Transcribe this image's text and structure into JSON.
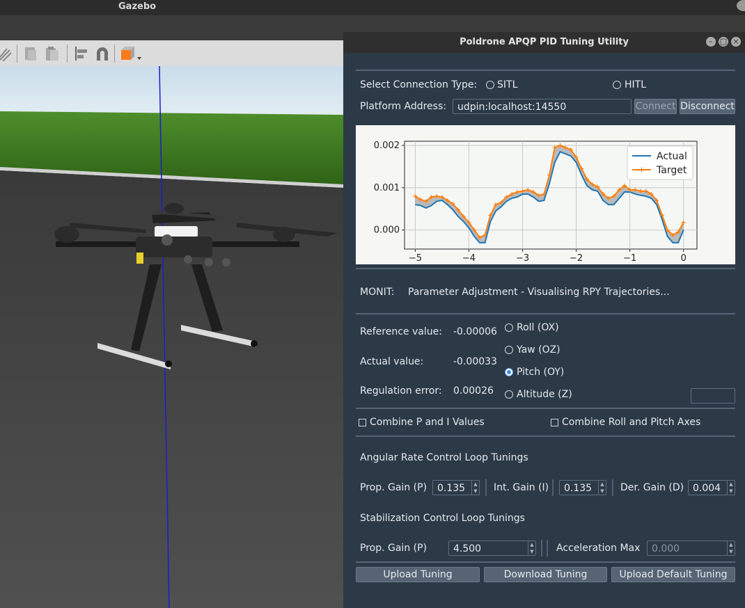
{
  "gazebo": {
    "title": "Gazebo"
  },
  "dialog": {
    "title": "Poldrone APQP PID Tuning Utility",
    "connection": {
      "label": "Select Connection Type:",
      "options": [
        "SITL",
        "HITL"
      ]
    },
    "address": {
      "label": "Platform Address:",
      "value": "udpin:localhost:14550",
      "connect_label": "Connect",
      "disconnect_label": "Disconnect"
    },
    "monit": {
      "label": "MONIT:",
      "status": "Parameter Adjustment - Visualising RPY Trajectories..."
    },
    "readouts": {
      "reference_label": "Reference value:",
      "reference_value": "-0.00006",
      "actual_label": "Actual value:",
      "actual_value": "-0.00033",
      "error_label": "Regulation error:",
      "error_value": "0.00026"
    },
    "axes": {
      "options": [
        "Roll (OX)",
        "Yaw (OZ)",
        "Pitch (OY)",
        "Altitude (Z)"
      ],
      "selected": "Pitch (OY)"
    },
    "checks": {
      "combine_pi": "Combine P and I Values",
      "combine_axes": "Combine Roll and Pitch Axes"
    },
    "angular": {
      "title": "Angular Rate Control Loop Tunings",
      "p_label": "Prop. Gain (P)",
      "p_value": "0.135",
      "i_label": "Int. Gain (I)",
      "i_value": "0.135",
      "d_label": "Der. Gain (D)",
      "d_value": "0.004"
    },
    "stabilization": {
      "title": "Stabilization Control Loop Tunings",
      "p_label": "Prop. Gain (P)",
      "p_value": "4.500",
      "acc_label": "Acceleration Max",
      "acc_value": "0.000"
    },
    "buttons": {
      "upload": "Upload Tuning",
      "download": "Download Tuning",
      "upload_default": "Upload Default Tuning"
    }
  },
  "chart_data": {
    "type": "line",
    "xlim": [
      -5.2,
      0.25
    ],
    "ylim": [
      -0.00045,
      0.0021
    ],
    "xticks": [
      -5,
      -4,
      -3,
      -2,
      -1,
      0
    ],
    "xtick_labels": [
      "−5",
      "−4",
      "−3",
      "−2",
      "−1",
      "0"
    ],
    "yticks": [
      0.0,
      0.001,
      0.002
    ],
    "ytick_labels": [
      "0.000",
      "0.001",
      "0.002"
    ],
    "grid": true,
    "legend": "top-right",
    "x": [
      -5.0,
      -4.9,
      -4.8,
      -4.7,
      -4.6,
      -4.5,
      -4.4,
      -4.3,
      -4.2,
      -4.1,
      -4.0,
      -3.9,
      -3.8,
      -3.7,
      -3.6,
      -3.5,
      -3.4,
      -3.3,
      -3.2,
      -3.1,
      -3.0,
      -2.9,
      -2.8,
      -2.7,
      -2.6,
      -2.5,
      -2.4,
      -2.3,
      -2.2,
      -2.1,
      -2.0,
      -1.9,
      -1.8,
      -1.7,
      -1.6,
      -1.5,
      -1.4,
      -1.3,
      -1.2,
      -1.1,
      -1.0,
      -0.9,
      -0.8,
      -0.7,
      -0.6,
      -0.5,
      -0.4,
      -0.3,
      -0.2,
      -0.1,
      0.0
    ],
    "series": [
      {
        "name": "Actual",
        "color": "#1f77b4",
        "values": [
          0.0006,
          0.00058,
          0.00052,
          0.00058,
          0.00068,
          0.0007,
          0.0006,
          0.00048,
          0.00032,
          0.0002,
          5e-05,
          -0.00015,
          -0.0003,
          -0.0003,
          0.0002,
          0.00045,
          0.00055,
          0.00068,
          0.00075,
          0.00078,
          0.00085,
          0.00085,
          0.00078,
          0.00068,
          0.0007,
          0.0011,
          0.0016,
          0.00185,
          0.0018,
          0.00175,
          0.0016,
          0.0013,
          0.00105,
          0.00095,
          0.00092,
          0.0007,
          0.0006,
          0.0006,
          0.00075,
          0.0009,
          0.0009,
          0.00085,
          0.00082,
          0.0008,
          0.00075,
          0.0006,
          0.00025,
          -0.00015,
          -0.0003,
          -0.0003,
          0.0
        ]
      },
      {
        "name": "Target",
        "color": "#ff7f0e",
        "values": [
          0.0008,
          0.00072,
          0.00068,
          0.00078,
          0.0008,
          0.00078,
          0.0007,
          0.00062,
          0.00048,
          0.00032,
          0.00018,
          0.0,
          -0.00018,
          -0.00012,
          0.00035,
          0.0006,
          0.00065,
          0.00078,
          0.00085,
          0.0009,
          0.00092,
          0.00095,
          0.0009,
          0.00082,
          0.00085,
          0.0013,
          0.00195,
          0.002,
          0.00195,
          0.0019,
          0.00172,
          0.00145,
          0.0012,
          0.00108,
          0.00102,
          0.00085,
          0.00075,
          0.0008,
          0.00095,
          0.00105,
          0.00095,
          0.00095,
          0.00092,
          0.00092,
          0.00085,
          0.0007,
          0.00035,
          0.0,
          -0.00012,
          -5e-05,
          0.00018
        ]
      }
    ]
  }
}
